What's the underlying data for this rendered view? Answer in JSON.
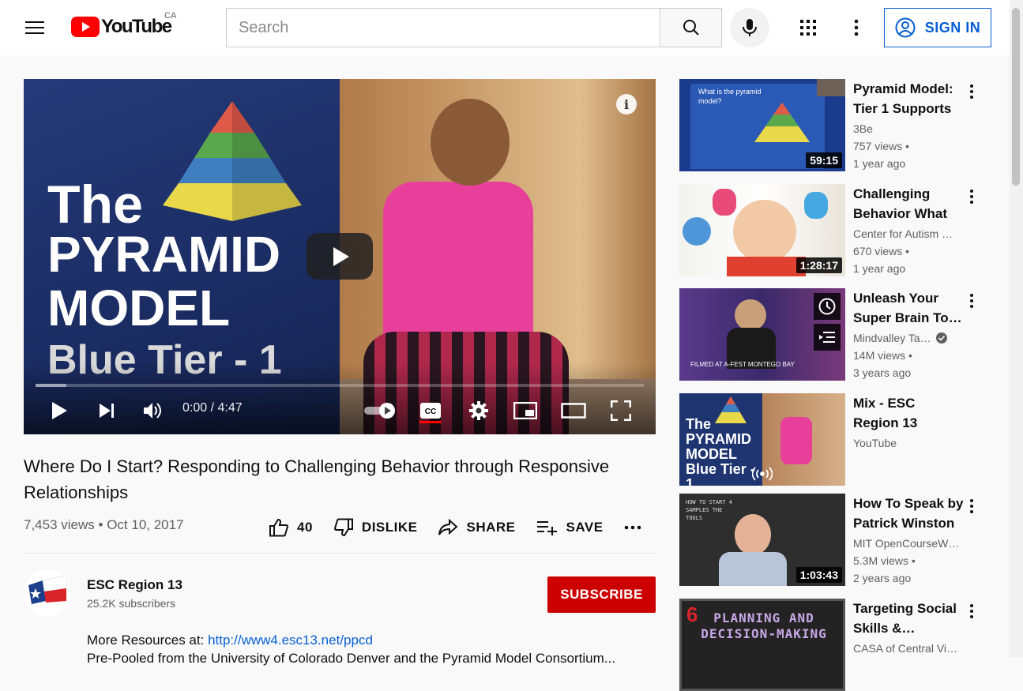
{
  "header": {
    "logo_text": "YouTube",
    "country_code": "CA",
    "search_placeholder": "Search",
    "sign_in_label": "SIGN IN"
  },
  "player": {
    "thumbnail_text": {
      "line1": "The",
      "line2": "PYRAMID",
      "line3": "MODEL",
      "line4": "Blue Tier - 1"
    },
    "time_display": "0:00 / 4:47",
    "info_label": "i",
    "cc_label": "CC"
  },
  "video": {
    "title": "Where Do I Start? Responding to Challenging Behavior through Responsive Relationships",
    "views": "7,453 views",
    "date": "Oct 10, 2017",
    "like_count": "40",
    "dislike_label": "DISLIKE",
    "share_label": "SHARE",
    "save_label": "SAVE"
  },
  "channel": {
    "name": "ESC Region 13",
    "subscribers": "25.2K subscribers",
    "subscribe_label": "SUBSCRIBE"
  },
  "description": {
    "line1_prefix": "More Resources at: ",
    "line1_link": "http://www4.esc13.net/ppcd",
    "line2": "Pre-Pooled from the University of Colorado Denver and the Pyramid Model Consortium..."
  },
  "recommendations": [
    {
      "title": "Pyramid Model: Tier 1 Supports",
      "channel": "3Be",
      "views": "757 views",
      "age": "1 year ago",
      "duration": "59:15",
      "thumb_text": "What is the pyramid model?"
    },
    {
      "title": "Challenging Behavior What i…",
      "channel": "Center for Autism …",
      "views": "670 views",
      "age": "1 year ago",
      "duration": "1:28:17"
    },
    {
      "title": "Unleash Your Super Brain To…",
      "channel": "Mindvalley Ta…",
      "views": "14M views",
      "age": "3 years ago",
      "duration": "",
      "thumb_text": "FILMED AT A-FEST MONTEGO BAY"
    },
    {
      "title": "Mix - ESC Region 13",
      "channel": "YouTube",
      "views": "",
      "age": "",
      "duration": "",
      "thumb_text": "The PYRAMID MODEL Blue Tier - 1"
    },
    {
      "title": "How To Speak by Patrick Winston",
      "channel": "MIT OpenCourseW…",
      "views": "5.3M views",
      "age": "2 years ago",
      "duration": "1:03:43",
      "thumb_text": "HOW TO START 4 SAMPLES THE TOOLS"
    },
    {
      "title": "Targeting Social Skills &…",
      "channel": "CASA of Central Vi…",
      "views": "",
      "age": "",
      "duration": "",
      "thumb_text": "PLANNING AND DECISION-MAKING"
    }
  ],
  "colors": {
    "brand_red": "#ff0000",
    "subscribe_red": "#cc0000",
    "link_blue": "#065fd4"
  }
}
